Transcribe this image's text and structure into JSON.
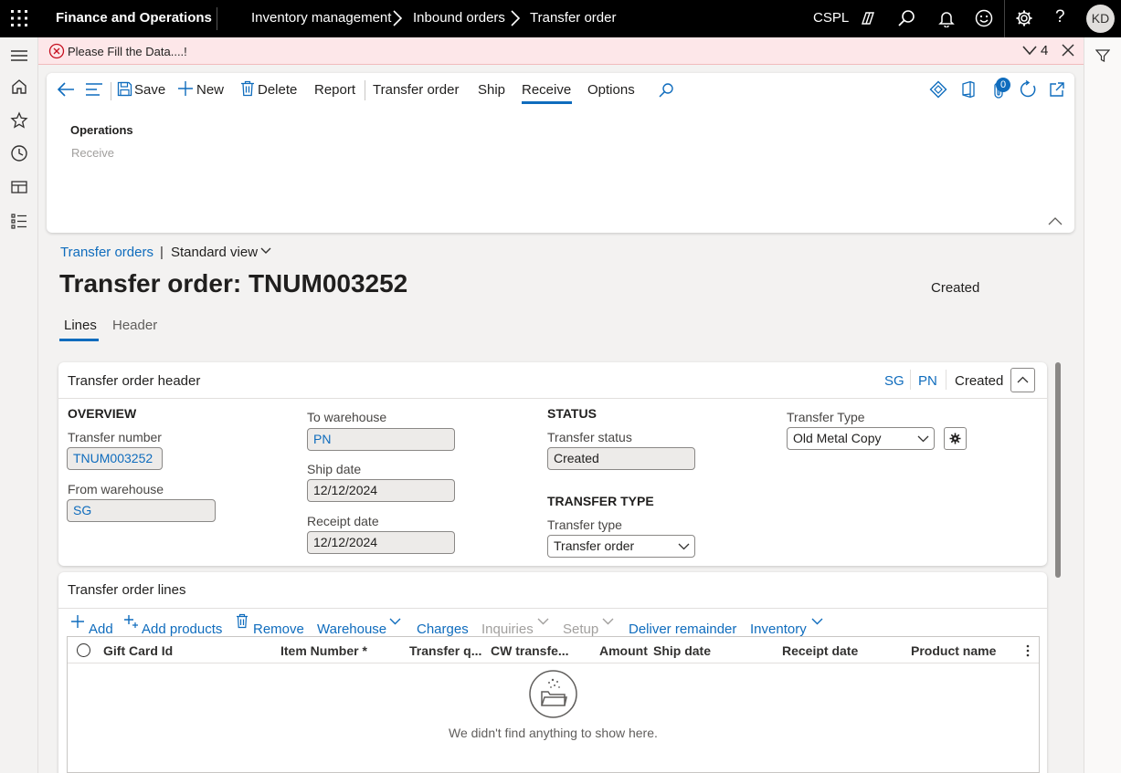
{
  "app": {
    "title": "Finance and Operations",
    "company": "CSPL",
    "user_initials": "KD"
  },
  "breadcrumb": [
    "Inventory management",
    "Inbound orders",
    "Transfer order"
  ],
  "message": {
    "text": "Please Fill the Data....!",
    "count": "4"
  },
  "action_pane": {
    "save": "Save",
    "new": "New",
    "delete": "Delete",
    "report": "Report",
    "tabs": [
      "Transfer order",
      "Ship",
      "Receive",
      "Options"
    ],
    "selected_tab": "Receive",
    "attachments_badge": "0",
    "group_title": "Operations",
    "group_item": "Receive"
  },
  "view": {
    "list_link": "Transfer orders",
    "view_name": "Standard view"
  },
  "record": {
    "title": "Transfer order: TNUM003252",
    "status": "Created"
  },
  "record_tabs": [
    "Lines",
    "Header"
  ],
  "header_card": {
    "title": "Transfer order header",
    "summary": [
      "SG",
      "PN",
      "Created"
    ],
    "overview_label": "OVERVIEW",
    "transfer_number_label": "Transfer number",
    "transfer_number": "TNUM003252",
    "from_warehouse_label": "From warehouse",
    "from_warehouse": "SG",
    "to_warehouse_label": "To warehouse",
    "to_warehouse": "PN",
    "ship_date_label": "Ship date",
    "ship_date": "12/12/2024",
    "receipt_date_label": "Receipt date",
    "receipt_date": "12/12/2024",
    "status_label": "STATUS",
    "transfer_status_label": "Transfer status",
    "transfer_status": "Created",
    "transfer_type_section": "TRANSFER TYPE",
    "transfer_type_label": "Transfer type",
    "transfer_type": "Transfer order",
    "custom_type_label": "Transfer Type",
    "custom_type": "Old Metal Copy"
  },
  "lines_card": {
    "title": "Transfer order lines",
    "toolbar": [
      "Add",
      "Add products",
      "Remove",
      "Warehouse",
      "Charges",
      "Inquiries",
      "Setup",
      "Deliver remainder",
      "Inventory"
    ],
    "columns": [
      "Gift Card Id",
      "Item Number *",
      "Transfer q...",
      "CW transfe...",
      "Amount",
      "Ship date",
      "Receipt date",
      "Product name"
    ],
    "empty_text": "We didn't find anything to show here."
  }
}
